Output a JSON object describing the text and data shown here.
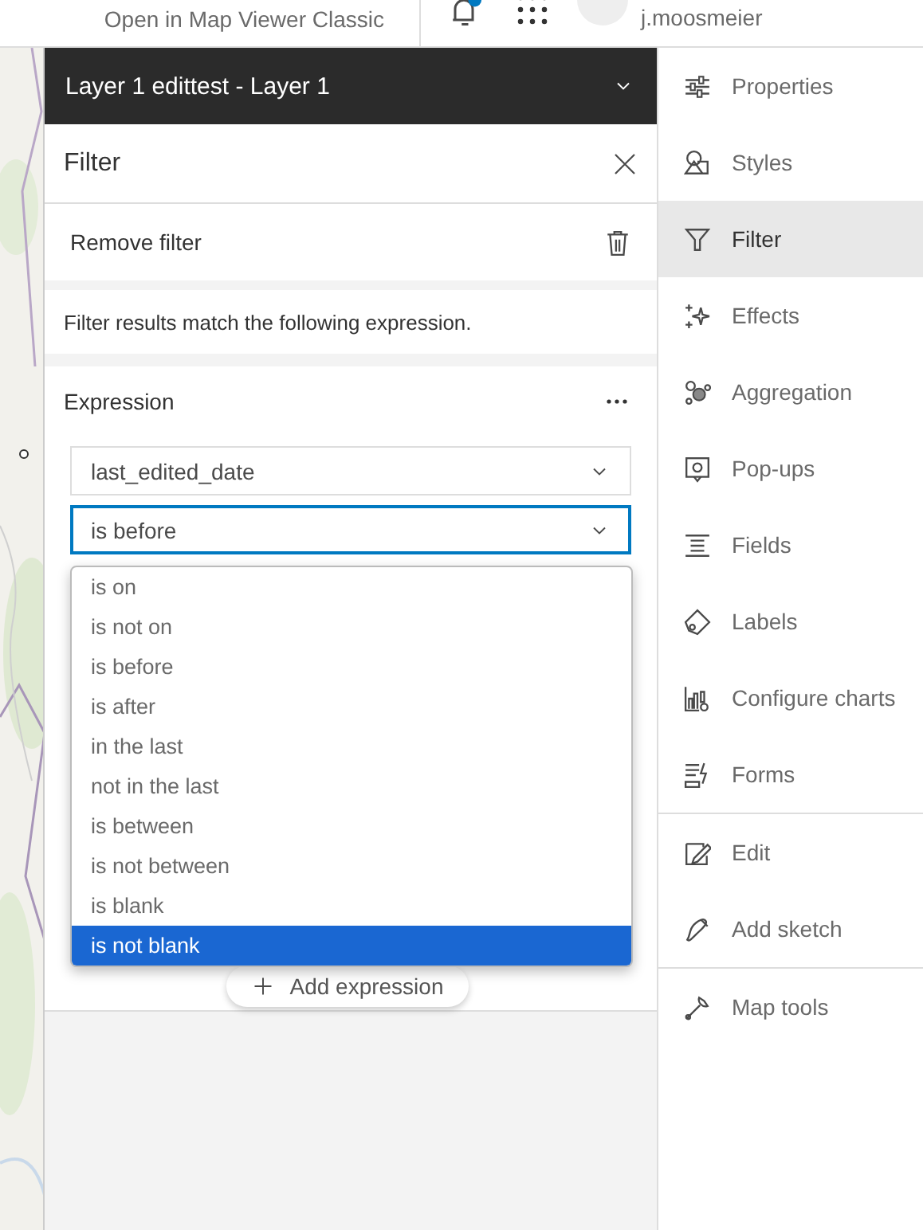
{
  "top_bar": {
    "link": "Open in Map Viewer Classic",
    "user": "j.moosmeier"
  },
  "layer_header": {
    "title": "Layer 1 edittest - Layer 1"
  },
  "filter_panel": {
    "title": "Filter",
    "remove_filter": "Remove filter",
    "description": "Filter results match the following expression.",
    "expression": {
      "title": "Expression",
      "field": "last_edited_date",
      "operator": "is before",
      "add_button": "Add expression"
    }
  },
  "operator_menu": {
    "options": [
      {
        "label": "is on",
        "highlighted": false
      },
      {
        "label": "is not on",
        "highlighted": false
      },
      {
        "label": "is before",
        "highlighted": false
      },
      {
        "label": "is after",
        "highlighted": false
      },
      {
        "label": "in the last",
        "highlighted": false
      },
      {
        "label": "not in the last",
        "highlighted": false
      },
      {
        "label": "is between",
        "highlighted": false
      },
      {
        "label": "is not between",
        "highlighted": false
      },
      {
        "label": "is blank",
        "highlighted": false
      },
      {
        "label": "is not blank",
        "highlighted": true
      }
    ]
  },
  "side_nav": {
    "groups": [
      [
        {
          "label": "Properties",
          "selected": false
        },
        {
          "label": "Styles",
          "selected": false
        },
        {
          "label": "Filter",
          "selected": true
        },
        {
          "label": "Effects",
          "selected": false
        },
        {
          "label": "Aggregation",
          "selected": false
        },
        {
          "label": "Pop-ups",
          "selected": false
        },
        {
          "label": "Fields",
          "selected": false
        },
        {
          "label": "Labels",
          "selected": false
        },
        {
          "label": "Configure charts",
          "selected": false
        },
        {
          "label": "Forms",
          "selected": false
        }
      ],
      [
        {
          "label": "Edit",
          "selected": false
        },
        {
          "label": "Add sketch",
          "selected": false
        }
      ],
      [
        {
          "label": "Map tools",
          "selected": false
        }
      ]
    ]
  }
}
